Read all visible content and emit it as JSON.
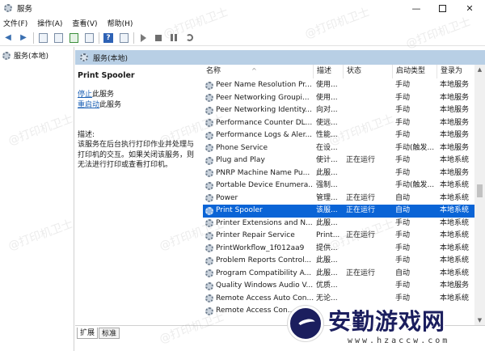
{
  "window": {
    "title": "服务",
    "minimize": "—",
    "close": "✕"
  },
  "menu": [
    "文件(F)",
    "操作(A)",
    "查看(V)",
    "帮助(H)"
  ],
  "tree": {
    "root_label": "服务(本地)"
  },
  "pane_header": {
    "label": "服务(本地)"
  },
  "detail": {
    "service_name": "Print Spooler",
    "stop_link": "停止",
    "stop_suffix": "此服务",
    "restart_link": "重启动",
    "restart_suffix": "此服务",
    "desc_label": "描述:",
    "desc_text": "该服务在后台执行打印作业并处理与打印机的交互。如果关闭该服务，则无法进行打印或查看打印机。"
  },
  "columns": [
    "名称",
    "描述",
    "状态",
    "启动类型",
    "登录为"
  ],
  "rows": [
    {
      "name": "Peer Name Resolution Pr...",
      "desc": "使用...",
      "status": "",
      "start": "手动",
      "logon": "本地服务",
      "selected": false
    },
    {
      "name": "Peer Networking Groupi...",
      "desc": "使用...",
      "status": "",
      "start": "手动",
      "logon": "本地服务",
      "selected": false
    },
    {
      "name": "Peer Networking Identity...",
      "desc": "向对...",
      "status": "",
      "start": "手动",
      "logon": "本地服务",
      "selected": false
    },
    {
      "name": "Performance Counter DL...",
      "desc": "使远...",
      "status": "",
      "start": "手动",
      "logon": "本地服务",
      "selected": false
    },
    {
      "name": "Performance Logs & Aler...",
      "desc": "性能...",
      "status": "",
      "start": "手动",
      "logon": "本地服务",
      "selected": false
    },
    {
      "name": "Phone Service",
      "desc": "在设...",
      "status": "",
      "start": "手动(触发...",
      "logon": "本地服务",
      "selected": false
    },
    {
      "name": "Plug and Play",
      "desc": "使计...",
      "status": "正在运行",
      "start": "手动",
      "logon": "本地系统",
      "selected": false
    },
    {
      "name": "PNRP Machine Name Pu...",
      "desc": "此服...",
      "status": "",
      "start": "手动",
      "logon": "本地服务",
      "selected": false
    },
    {
      "name": "Portable Device Enumera...",
      "desc": "强制...",
      "status": "",
      "start": "手动(触发...",
      "logon": "本地系统",
      "selected": false
    },
    {
      "name": "Power",
      "desc": "管理...",
      "status": "正在运行",
      "start": "自动",
      "logon": "本地系统",
      "selected": false
    },
    {
      "name": "Print Spooler",
      "desc": "该服...",
      "status": "正在运行",
      "start": "自动",
      "logon": "本地系统",
      "selected": true
    },
    {
      "name": "Printer Extensions and N...",
      "desc": "此服...",
      "status": "",
      "start": "手动",
      "logon": "本地系统",
      "selected": false
    },
    {
      "name": "Printer Repair Service",
      "desc": "Print...",
      "status": "正在运行",
      "start": "手动",
      "logon": "本地系统",
      "selected": false
    },
    {
      "name": "PrintWorkflow_1f012aa9",
      "desc": "提供...",
      "status": "",
      "start": "手动",
      "logon": "本地系统",
      "selected": false
    },
    {
      "name": "Problem Reports Control...",
      "desc": "此服...",
      "status": "",
      "start": "手动",
      "logon": "本地系统",
      "selected": false
    },
    {
      "name": "Program Compatibility A...",
      "desc": "此服...",
      "status": "正在运行",
      "start": "自动",
      "logon": "本地系统",
      "selected": false
    },
    {
      "name": "Quality Windows Audio V...",
      "desc": "优质...",
      "status": "",
      "start": "手动",
      "logon": "本地服务",
      "selected": false
    },
    {
      "name": "Remote Access Auto Con...",
      "desc": "无论...",
      "status": "",
      "start": "手动",
      "logon": "本地系统",
      "selected": false
    },
    {
      "name": "Remote Access Con...",
      "desc": "",
      "status": "",
      "start": "",
      "logon": "",
      "selected": false
    }
  ],
  "tabs": [
    "扩展",
    "标准"
  ],
  "watermark": "@打印机卫士",
  "brand": {
    "title": "安勤游戏网",
    "url": "www.hzaccw.com"
  },
  "icons": {
    "back": "back-arrow-icon",
    "forward": "forward-arrow-icon",
    "help": "help-icon",
    "start": "play-icon",
    "stop": "stop-icon",
    "pause": "pause-icon",
    "restart": "restart-icon"
  }
}
